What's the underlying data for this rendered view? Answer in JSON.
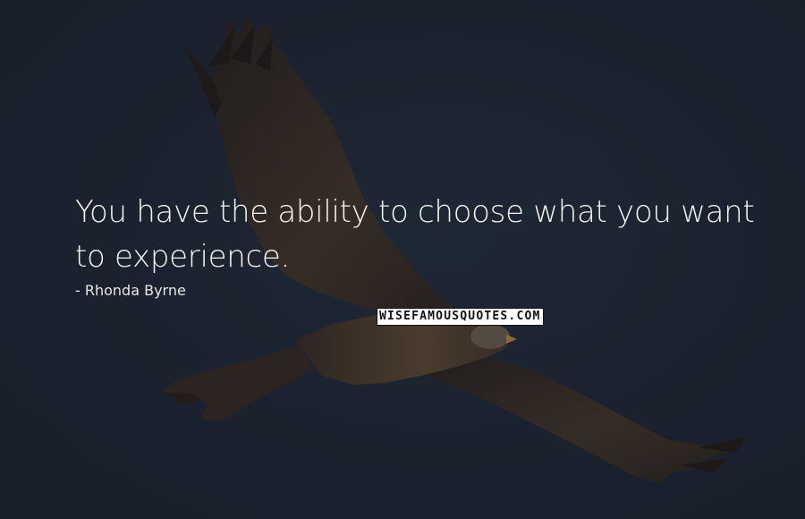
{
  "quote": {
    "text": "You have the ability to choose what you want to experience.",
    "author": "- Rhonda Byrne"
  },
  "watermark": {
    "text": "WISEFAMOUSQUOTES.COM"
  },
  "colors": {
    "background": "#1d2533",
    "bird_dark": "#2a2018",
    "bird_mid": "#4a3827",
    "bird_light": "#6a5134",
    "text": "#f3f3f0"
  }
}
